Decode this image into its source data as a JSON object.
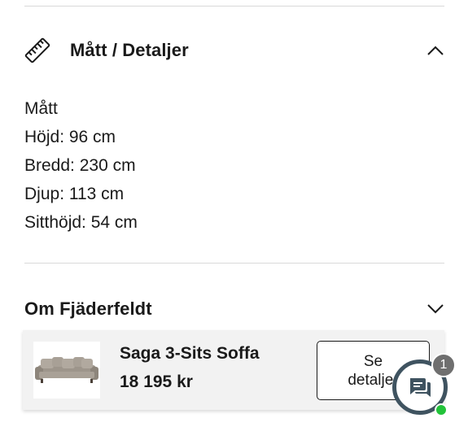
{
  "measure_section": {
    "title": "Mått / Detaljer",
    "icon": "ruler-icon",
    "expanded": true,
    "lines": [
      "Mått",
      "Höjd: 96 cm",
      "Bredd: 230 cm",
      "Djup: 113 cm",
      "Sitthöjd: 54 cm"
    ]
  },
  "about_section": {
    "title": "Om Fjäderfeldt",
    "expanded": false
  },
  "sticky_bar": {
    "product_name": "Saga 3-Sits Soffa",
    "price": "18 195 kr",
    "button_label": "Se detaljer"
  },
  "chat": {
    "badge_count": "1",
    "status_color": "#22c33a",
    "ring_color": "#3f5360"
  }
}
